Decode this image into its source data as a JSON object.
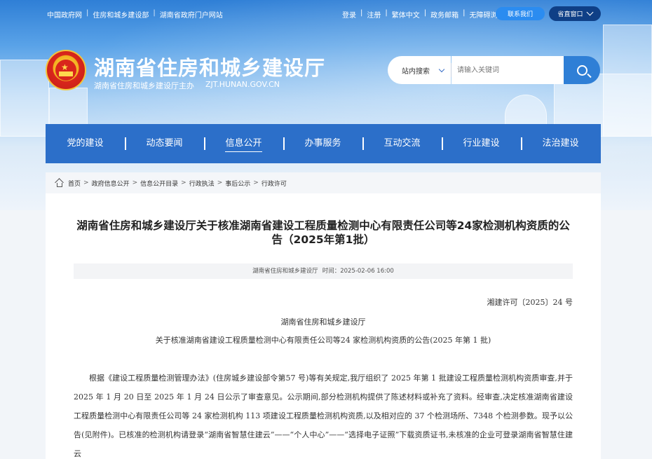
{
  "topbar": {
    "links": [
      "中国政府网",
      "住房和城乡建设部",
      "湖南省政府门户网站"
    ],
    "right_links": [
      "登录",
      "注册",
      "繁体中文",
      "政务邮箱",
      "无障碍浏览"
    ],
    "contact_label": "联系我们",
    "window_label": "省直窗口"
  },
  "header": {
    "title": "湖南省住房和城乡建设厅",
    "sponsor": "湖南省住房和城乡建设厅主办",
    "domain": "ZJT.HUNAN.GOV.CN"
  },
  "search": {
    "scope": "站内搜索",
    "placeholder": "请输入关键词"
  },
  "nav": {
    "items": [
      "党的建设",
      "动态要闻",
      "信息公开",
      "办事服务",
      "互动交流",
      "行业建设",
      "法治建设"
    ],
    "active": "信息公开"
  },
  "breadcrumb": [
    "首页",
    "政府信息公开",
    "信息公开目录",
    "行政执法",
    "事后公示",
    "行政许可"
  ],
  "article": {
    "title": "湖南省住房和城乡建设厅关于核准湖南省建设工程质量检测中心有限责任公司等24家检测机构资质的公告（2025年第1批）",
    "source": "湖南省住房和城乡建设厅",
    "time_label": "时间：",
    "time": "2025-02-06 16:00",
    "doc_number": "湘建许可〔2025〕24 号",
    "org": "湖南省住房和城乡建设厅",
    "subject": "关于核准湖南省建设工程质量检测中心有限责任公司等24 家检测机构资质的公告(2025 年第 1 批)",
    "paragraph": "根据《建设工程质量检测管理办法》(住房城乡建设部令第57 号)等有关规定,我厅组织了 2025 年第 1 批建设工程质量检测机构资质审查,并于 2025 年 1 月 20 日至 2025 年 1 月 24 日公示了审查意见。公示期间,部分检测机构提供了陈述材料或补充了资料。经审查,决定核准湖南省建设工程质量检测中心有限责任公司等 24 家检测机构 113 项建设工程质量检测机构资质,以及相对应的 37 个检测场所、7348 个检测参数。现予以公告(见附件)。已核准的检测机构请登录“湖南省智慧住建云”——“个人中心”——“选择电子证照”下载资质证书,未核准的企业可登录湖南省智慧住建云"
  }
}
